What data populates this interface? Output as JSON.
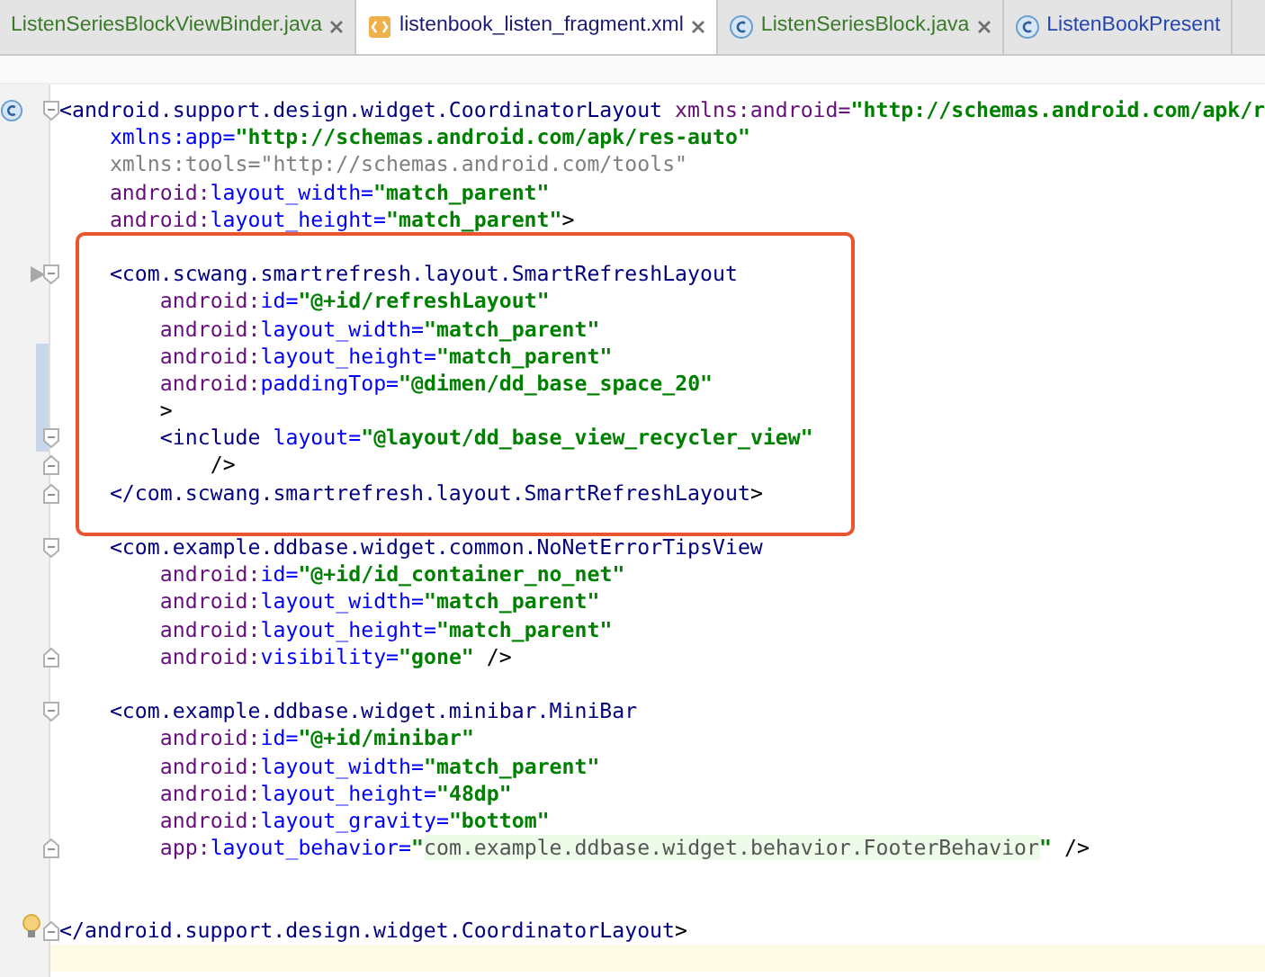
{
  "tabs": [
    {
      "label": "ListenSeriesBlockViewBinder.java",
      "kind": "plain",
      "color": "#3a7a2a",
      "selected": false,
      "closable": true
    },
    {
      "label": "listenbook_listen_fragment.xml",
      "kind": "xml",
      "color": "#1a1a6e",
      "selected": true,
      "closable": true
    },
    {
      "label": "ListenSeriesBlock.java",
      "kind": "class",
      "color": "#3a7a2a",
      "selected": false,
      "closable": true
    },
    {
      "label": "ListenBookPresent",
      "kind": "class",
      "color": "#2545b0",
      "selected": false,
      "closable": false
    }
  ],
  "lines": [
    {
      "kind": "code",
      "gutter": [
        {
          "kind": "class"
        },
        {
          "kind": "fold_open"
        }
      ],
      "tokens": [
        {
          "kind": "tag",
          "text": "<android.support.design.widget.CoordinatorLayout"
        },
        {
          "kind": "ns",
          "text": " xmlns:android="
        },
        {
          "kind": "value",
          "text": "\"http://schemas.android.com/apk/r"
        }
      ],
      "children": [
        {
          "kind": "code",
          "tokens": [
            {
              "kind": "attr",
              "text": "xmlns:app="
            },
            {
              "kind": "value",
              "text": "\"http://schemas.android.com/apk/res-auto\""
            }
          ]
        },
        {
          "kind": "code",
          "tokens": [
            {
              "kind": "gray",
              "text": "xmlns:tools=\"http://schemas.android.com/tools\""
            }
          ]
        },
        {
          "kind": "code",
          "tokens": [
            {
              "kind": "ns",
              "text": "android:"
            },
            {
              "kind": "attr",
              "text": "layout_width="
            },
            {
              "kind": "value",
              "text": "\"match_parent\""
            }
          ]
        },
        {
          "kind": "code",
          "tokens": [
            {
              "kind": "ns",
              "text": "android:"
            },
            {
              "kind": "attr",
              "text": "layout_height="
            },
            {
              "kind": "value",
              "text": "\"match_parent\""
            },
            {
              "kind": "punct",
              "text": ">"
            }
          ]
        },
        {
          "kind": "box",
          "color": "#e8552e",
          "children": [
            {
              "kind": "blank"
            },
            {
              "kind": "code",
              "gutter": [
                {
                  "kind": "arrow"
                },
                {
                  "kind": "fold_open"
                }
              ],
              "tokens": [
                {
                  "kind": "tag",
                  "text": "<com.scwang.smartrefresh.layout.SmartRefreshLayout"
                }
              ],
              "children": [
                {
                  "kind": "code",
                  "tokens": [
                    {
                      "kind": "ns",
                      "text": "android:"
                    },
                    {
                      "kind": "attr",
                      "text": "id="
                    },
                    {
                      "kind": "value",
                      "text": "\"@+id/refreshLayout\""
                    }
                  ]
                },
                {
                  "kind": "code",
                  "tokens": [
                    {
                      "kind": "ns",
                      "text": "android:"
                    },
                    {
                      "kind": "attr",
                      "text": "layout_width="
                    },
                    {
                      "kind": "value",
                      "text": "\"match_parent\""
                    }
                  ]
                },
                {
                  "kind": "code",
                  "gutter": [
                    {
                      "kind": "change"
                    }
                  ],
                  "tokens": [
                    {
                      "kind": "ns",
                      "text": "android:"
                    },
                    {
                      "kind": "attr",
                      "text": "layout_height="
                    },
                    {
                      "kind": "value",
                      "text": "\"match_parent\""
                    }
                  ]
                },
                {
                  "kind": "code",
                  "gutter": [
                    {
                      "kind": "change"
                    }
                  ],
                  "tokens": [
                    {
                      "kind": "ns",
                      "text": "android:"
                    },
                    {
                      "kind": "attr",
                      "text": "paddingTop="
                    },
                    {
                      "kind": "value",
                      "text": "\"@dimen/dd_base_space_20\""
                    }
                  ]
                },
                {
                  "kind": "code",
                  "gutter": [
                    {
                      "kind": "change"
                    }
                  ],
                  "tokens": [
                    {
                      "kind": "punct",
                      "text": ">"
                    }
                  ]
                },
                {
                  "kind": "code",
                  "gutter": [
                    {
                      "kind": "change"
                    },
                    {
                      "kind": "fold_open"
                    }
                  ],
                  "tokens": [
                    {
                      "kind": "tag",
                      "text": "<include"
                    },
                    {
                      "kind": "attr",
                      "text": " layout="
                    },
                    {
                      "kind": "value",
                      "text": "\"@layout/dd_base_view_recycler_view\""
                    }
                  ],
                  "children": [
                    {
                      "kind": "code",
                      "gutter": [
                        {
                          "kind": "fold_close"
                        }
                      ],
                      "tokens": [
                        {
                          "kind": "punct",
                          "text": "/>"
                        }
                      ]
                    }
                  ]
                }
              ]
            },
            {
              "kind": "code",
              "gutter": [
                {
                  "kind": "fold_close"
                }
              ],
              "tokens": [
                {
                  "kind": "tag",
                  "text": "</com.scwang.smartrefresh.layout.SmartRefreshLayout"
                },
                {
                  "kind": "punct",
                  "text": ">"
                }
              ]
            },
            {
              "kind": "blank"
            }
          ]
        },
        {
          "kind": "code",
          "gutter": [
            {
              "kind": "fold_open"
            }
          ],
          "tokens": [
            {
              "kind": "tag",
              "text": "<com.example.ddbase.widget.common.NoNetErrorTipsView"
            }
          ],
          "children": [
            {
              "kind": "code",
              "tokens": [
                {
                  "kind": "ns",
                  "text": "android:"
                },
                {
                  "kind": "attr",
                  "text": "id="
                },
                {
                  "kind": "value",
                  "text": "\"@+id/id_container_no_net\""
                }
              ]
            },
            {
              "kind": "code",
              "tokens": [
                {
                  "kind": "ns",
                  "text": "android:"
                },
                {
                  "kind": "attr",
                  "text": "layout_width="
                },
                {
                  "kind": "value",
                  "text": "\"match_parent\""
                }
              ]
            },
            {
              "kind": "code",
              "tokens": [
                {
                  "kind": "ns",
                  "text": "android:"
                },
                {
                  "kind": "attr",
                  "text": "layout_height="
                },
                {
                  "kind": "value",
                  "text": "\"match_parent\""
                }
              ]
            },
            {
              "kind": "code",
              "gutter": [
                {
                  "kind": "fold_close"
                }
              ],
              "tokens": [
                {
                  "kind": "ns",
                  "text": "android:"
                },
                {
                  "kind": "attr",
                  "text": "visibility="
                },
                {
                  "kind": "value",
                  "text": "\"gone\""
                },
                {
                  "kind": "punct",
                  "text": " />"
                }
              ]
            }
          ]
        },
        {
          "kind": "blank"
        },
        {
          "kind": "code",
          "gutter": [
            {
              "kind": "fold_open"
            }
          ],
          "tokens": [
            {
              "kind": "tag",
              "text": "<com.example.ddbase.widget.minibar.MiniBar"
            }
          ],
          "children": [
            {
              "kind": "code",
              "tokens": [
                {
                  "kind": "ns",
                  "text": "android:"
                },
                {
                  "kind": "attr",
                  "text": "id="
                },
                {
                  "kind": "value",
                  "text": "\"@+id/minibar\""
                }
              ]
            },
            {
              "kind": "code",
              "tokens": [
                {
                  "kind": "ns",
                  "text": "android:"
                },
                {
                  "kind": "attr",
                  "text": "layout_width="
                },
                {
                  "kind": "value",
                  "text": "\"match_parent\""
                }
              ]
            },
            {
              "kind": "code",
              "tokens": [
                {
                  "kind": "ns",
                  "text": "android:"
                },
                {
                  "kind": "attr",
                  "text": "layout_height="
                },
                {
                  "kind": "value",
                  "text": "\"48dp\""
                }
              ]
            },
            {
              "kind": "code",
              "tokens": [
                {
                  "kind": "ns",
                  "text": "android:"
                },
                {
                  "kind": "attr",
                  "text": "layout_gravity="
                },
                {
                  "kind": "value",
                  "text": "\"bottom\""
                }
              ]
            },
            {
              "kind": "code",
              "gutter": [
                {
                  "kind": "fold_close"
                }
              ],
              "tokens": [
                {
                  "kind": "ns",
                  "text": "app:"
                },
                {
                  "kind": "attr",
                  "text": "layout_behavior="
                },
                {
                  "kind": "value",
                  "text": "\""
                },
                {
                  "kind": "value_hl",
                  "text": "com.example.ddbase.widget.behavior.FooterBehavior"
                },
                {
                  "kind": "value",
                  "text": "\""
                },
                {
                  "kind": "punct",
                  "text": " />"
                }
              ]
            }
          ]
        },
        {
          "kind": "blank"
        },
        {
          "kind": "blank"
        }
      ]
    },
    {
      "kind": "code",
      "gutter": [
        {
          "kind": "fold_close"
        },
        {
          "kind": "bulb"
        }
      ],
      "tokens": [
        {
          "kind": "tag",
          "text": "</android.support.design.widget.CoordinatorLayout"
        },
        {
          "kind": "punct",
          "text": ">"
        }
      ]
    },
    {
      "kind": "current"
    }
  ]
}
